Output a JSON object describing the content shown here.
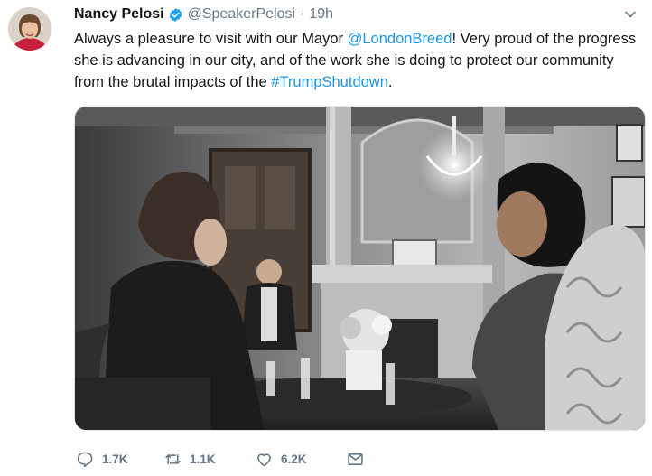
{
  "tweet": {
    "author_name": "Nancy Pelosi",
    "author_handle": "@SpeakerPelosi",
    "separator": "·",
    "time": "19h",
    "text_part1": "Always a pleasure to visit with our Mayor ",
    "mention": "@LondonBreed",
    "text_part2": "! Very proud of the progress she is advancing in our city, and of the work she is doing to protect our community from the brutal impacts of the ",
    "hashtag": "#TrumpShutdown",
    "text_part3": "."
  },
  "actions": {
    "replies": "1.7K",
    "retweets": "1.1K",
    "likes": "6.2K"
  },
  "icons": {
    "verified": "verified-badge-icon",
    "caret": "chevron-down-icon",
    "reply": "speech-bubble-icon",
    "retweet": "retweet-arrows-icon",
    "like": "heart-icon",
    "dm": "envelope-icon"
  },
  "colors": {
    "link": "#1b95e0",
    "text": "#14171a",
    "muted": "#657786",
    "verified": "#1da1f2"
  }
}
